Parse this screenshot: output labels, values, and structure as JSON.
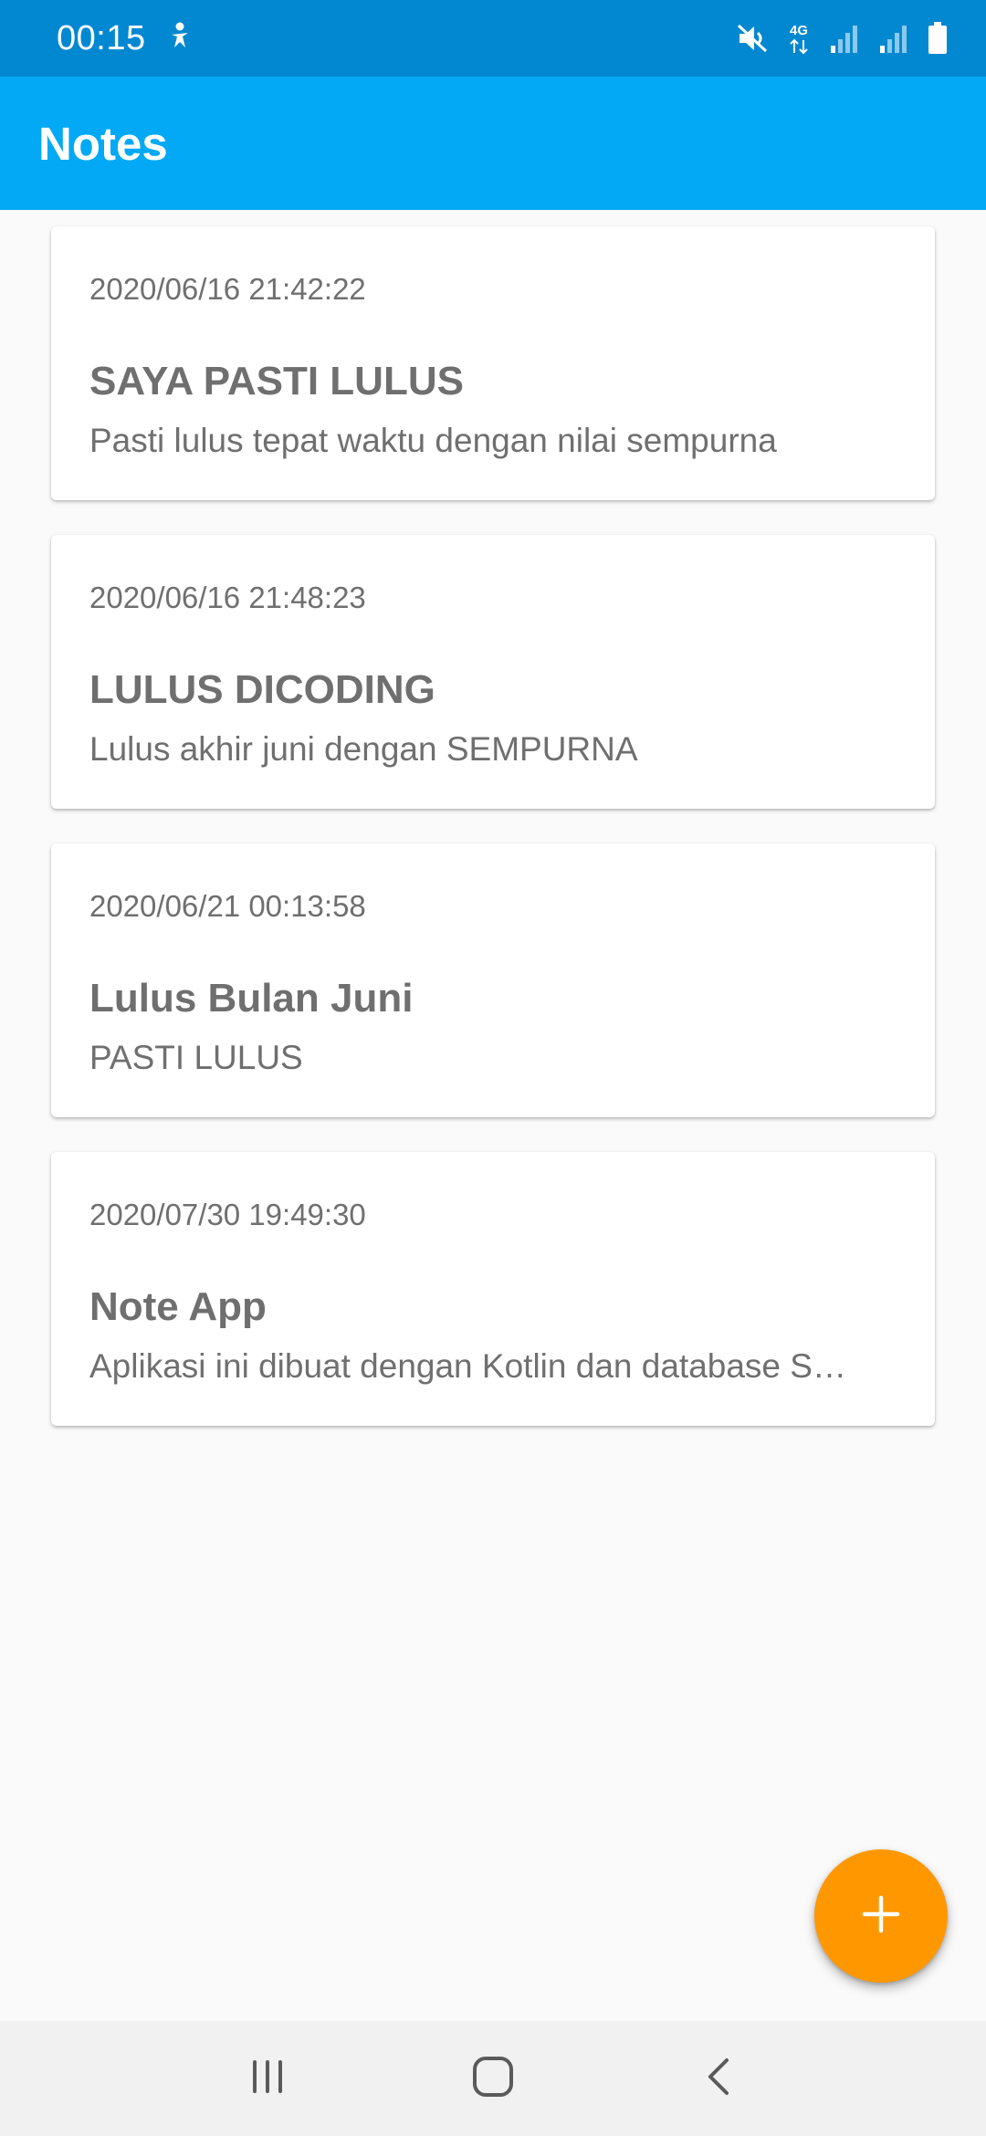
{
  "status_bar": {
    "time": "00:15",
    "network": "4G",
    "icons": [
      "accessibility-icon",
      "mute-icon",
      "network-4g-icon",
      "signal-icon",
      "signal-icon",
      "battery-icon"
    ]
  },
  "app_bar": {
    "title": "Notes"
  },
  "notes": [
    {
      "date": "2020/06/16 21:42:22",
      "title": "SAYA PASTI LULUS",
      "description": "Pasti lulus tepat waktu dengan nilai sempurna"
    },
    {
      "date": "2020/06/16 21:48:23",
      "title": "LULUS DICODING",
      "description": "Lulus akhir juni dengan SEMPURNA"
    },
    {
      "date": "2020/06/21 00:13:58",
      "title": "Lulus Bulan Juni",
      "description": "PASTI LULUS"
    },
    {
      "date": "2020/07/30 19:49:30",
      "title": "Note App",
      "description": "Aplikasi ini dibuat dengan Kotlin dan database S…"
    }
  ],
  "fab": {
    "icon": "plus-icon"
  },
  "nav_bar": {
    "buttons": [
      "recent-apps-icon",
      "home-icon",
      "back-icon"
    ]
  },
  "colors": {
    "status_bar": "#0288d1",
    "app_bar": "#03a9f4",
    "fab": "#ff9800",
    "text_secondary": "#6f6f6f"
  }
}
